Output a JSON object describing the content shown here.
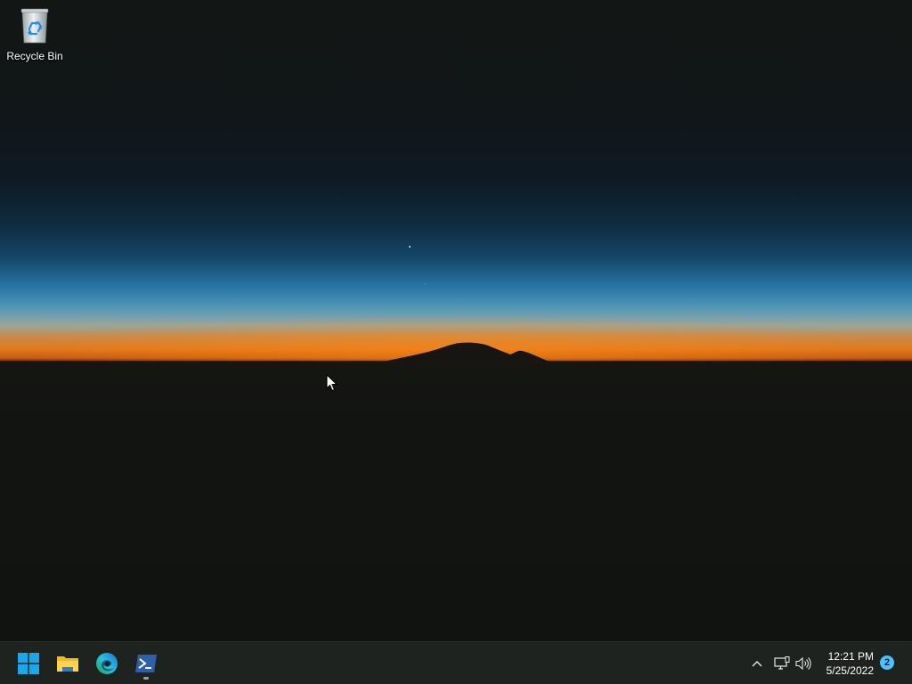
{
  "desktop": {
    "wallpaper": "night-sky-mountain-horizon",
    "icons": [
      {
        "label": "Recycle Bin",
        "icon": "recycle-bin-icon"
      }
    ]
  },
  "taskbar": {
    "pinned": [
      {
        "name": "Start",
        "icon": "windows-start-icon"
      },
      {
        "name": "File Explorer",
        "icon": "folder-icon"
      },
      {
        "name": "Microsoft Edge",
        "icon": "edge-icon"
      },
      {
        "name": "Windows PowerShell",
        "icon": "powershell-icon",
        "running": true
      }
    ],
    "tray": {
      "icons": [
        "chevron-up-icon",
        "network-icon",
        "volume-icon"
      ],
      "time": "12:21 PM",
      "date": "5/25/2022",
      "notification_count": "2"
    }
  },
  "colors": {
    "taskbar_bg": "#1e2320",
    "accent_start": "#1ea7e8",
    "notification_badge": "#4cc2ff"
  }
}
